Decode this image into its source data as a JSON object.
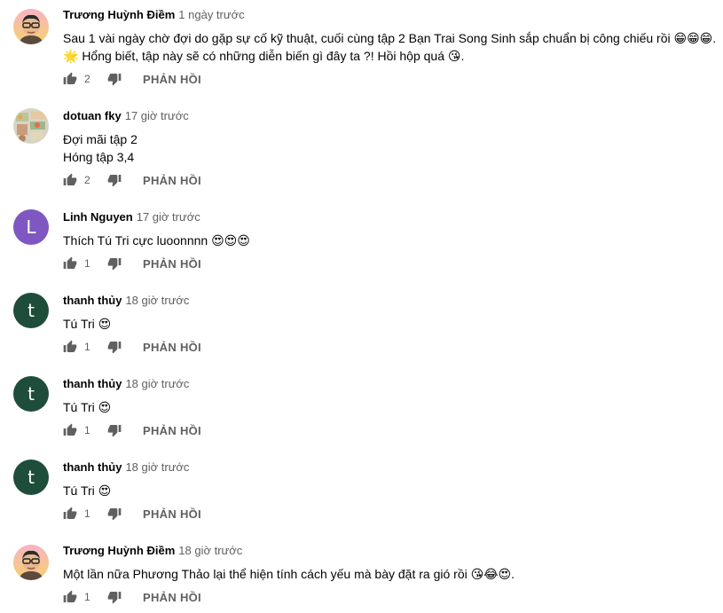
{
  "ui": {
    "reply_label": "PHẢN HỒI"
  },
  "comments": [
    {
      "author": "Trương Huỳnh Điềm",
      "time": "1 ngày trước",
      "lines": [
        "Sau 1 vài ngày chờ đợi do gặp sự cố kỹ thuật, cuối cùng tập 2 Bạn Trai Song Sinh sắp chuẩn bị công chiếu rồi 😁😁😁.",
        "🌟 Hổng biết, tập này sẽ có những diễn biến gì đây ta ?! Hồi hộp quá 😘."
      ],
      "likes": "2",
      "avatar": {
        "type": "illustration",
        "icon": "man-glasses-avatar"
      }
    },
    {
      "author": "dotuan fky",
      "time": "17 giờ trước",
      "lines": [
        "Đợi mãi tập 2",
        "Hóng tập 3,4"
      ],
      "likes": "2",
      "avatar": {
        "type": "photo",
        "icon": "food-photo-avatar"
      }
    },
    {
      "author": "Linh Nguyen",
      "time": "17 giờ trước",
      "lines": [
        "Thích Tú Tri cực luoonnnn 😍😍😍"
      ],
      "likes": "1",
      "avatar": {
        "type": "letter",
        "letter": "L",
        "color": "#7e57c2"
      }
    },
    {
      "author": "thanh thủy",
      "time": "18 giờ trước",
      "lines": [
        "Tú Tri 😍"
      ],
      "likes": "1",
      "avatar": {
        "type": "letter",
        "letter": "t",
        "color": "#1e4d3a"
      }
    },
    {
      "author": "thanh thủy",
      "time": "18 giờ trước",
      "lines": [
        "Tú Tri 😍"
      ],
      "likes": "1",
      "avatar": {
        "type": "letter",
        "letter": "t",
        "color": "#1e4d3a"
      }
    },
    {
      "author": "thanh thủy",
      "time": "18 giờ trước",
      "lines": [
        "Tú Tri 😍"
      ],
      "likes": "1",
      "avatar": {
        "type": "letter",
        "letter": "t",
        "color": "#1e4d3a"
      }
    },
    {
      "author": "Trương Huỳnh Điềm",
      "time": "18 giờ trước",
      "lines": [
        "Một lần nữa Phương Thảo lại thể hiện tính cách yếu mà bày đặt ra gió rồi 😘😂😍."
      ],
      "likes": "1",
      "avatar": {
        "type": "illustration",
        "icon": "man-glasses-avatar"
      }
    }
  ]
}
